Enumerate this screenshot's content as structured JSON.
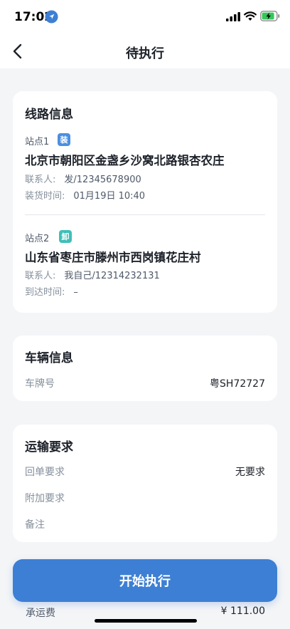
{
  "status_bar": {
    "time": "17:02"
  },
  "nav": {
    "title": "待执行"
  },
  "route_card": {
    "title": "线路信息",
    "stops": [
      {
        "label": "站点1",
        "tag": "装",
        "tag_color": "#4a8fe0",
        "address": "北京市朝阳区金盏乡沙窝北路银杏农庄",
        "contact_label": "联系人:",
        "contact_value": "发/12345678900",
        "time_label": "装货时间:",
        "time_value": "01月19日 10:40"
      },
      {
        "label": "站点2",
        "tag": "卸",
        "tag_color": "#3fbfb8",
        "address": "山东省枣庄市滕州市西岗镇花庄村",
        "contact_label": "联系人:",
        "contact_value": "我自己/12314232131",
        "time_label": "到达时间:",
        "time_value": "–"
      }
    ]
  },
  "vehicle_card": {
    "title": "车辆信息",
    "plate_label": "车牌号",
    "plate_value": "粤SH72727"
  },
  "transport_card": {
    "title": "运输要求",
    "receipt_label": "回单要求",
    "receipt_value": "无要求",
    "extra_label": "附加要求",
    "remark_label": "备注"
  },
  "footer": {
    "start_button_label": "开始执行",
    "fee_label": "承运费",
    "fee_value": "¥ 111.00"
  },
  "colors": {
    "primary": "#3d7fd4",
    "background": "#f4f5f7"
  }
}
